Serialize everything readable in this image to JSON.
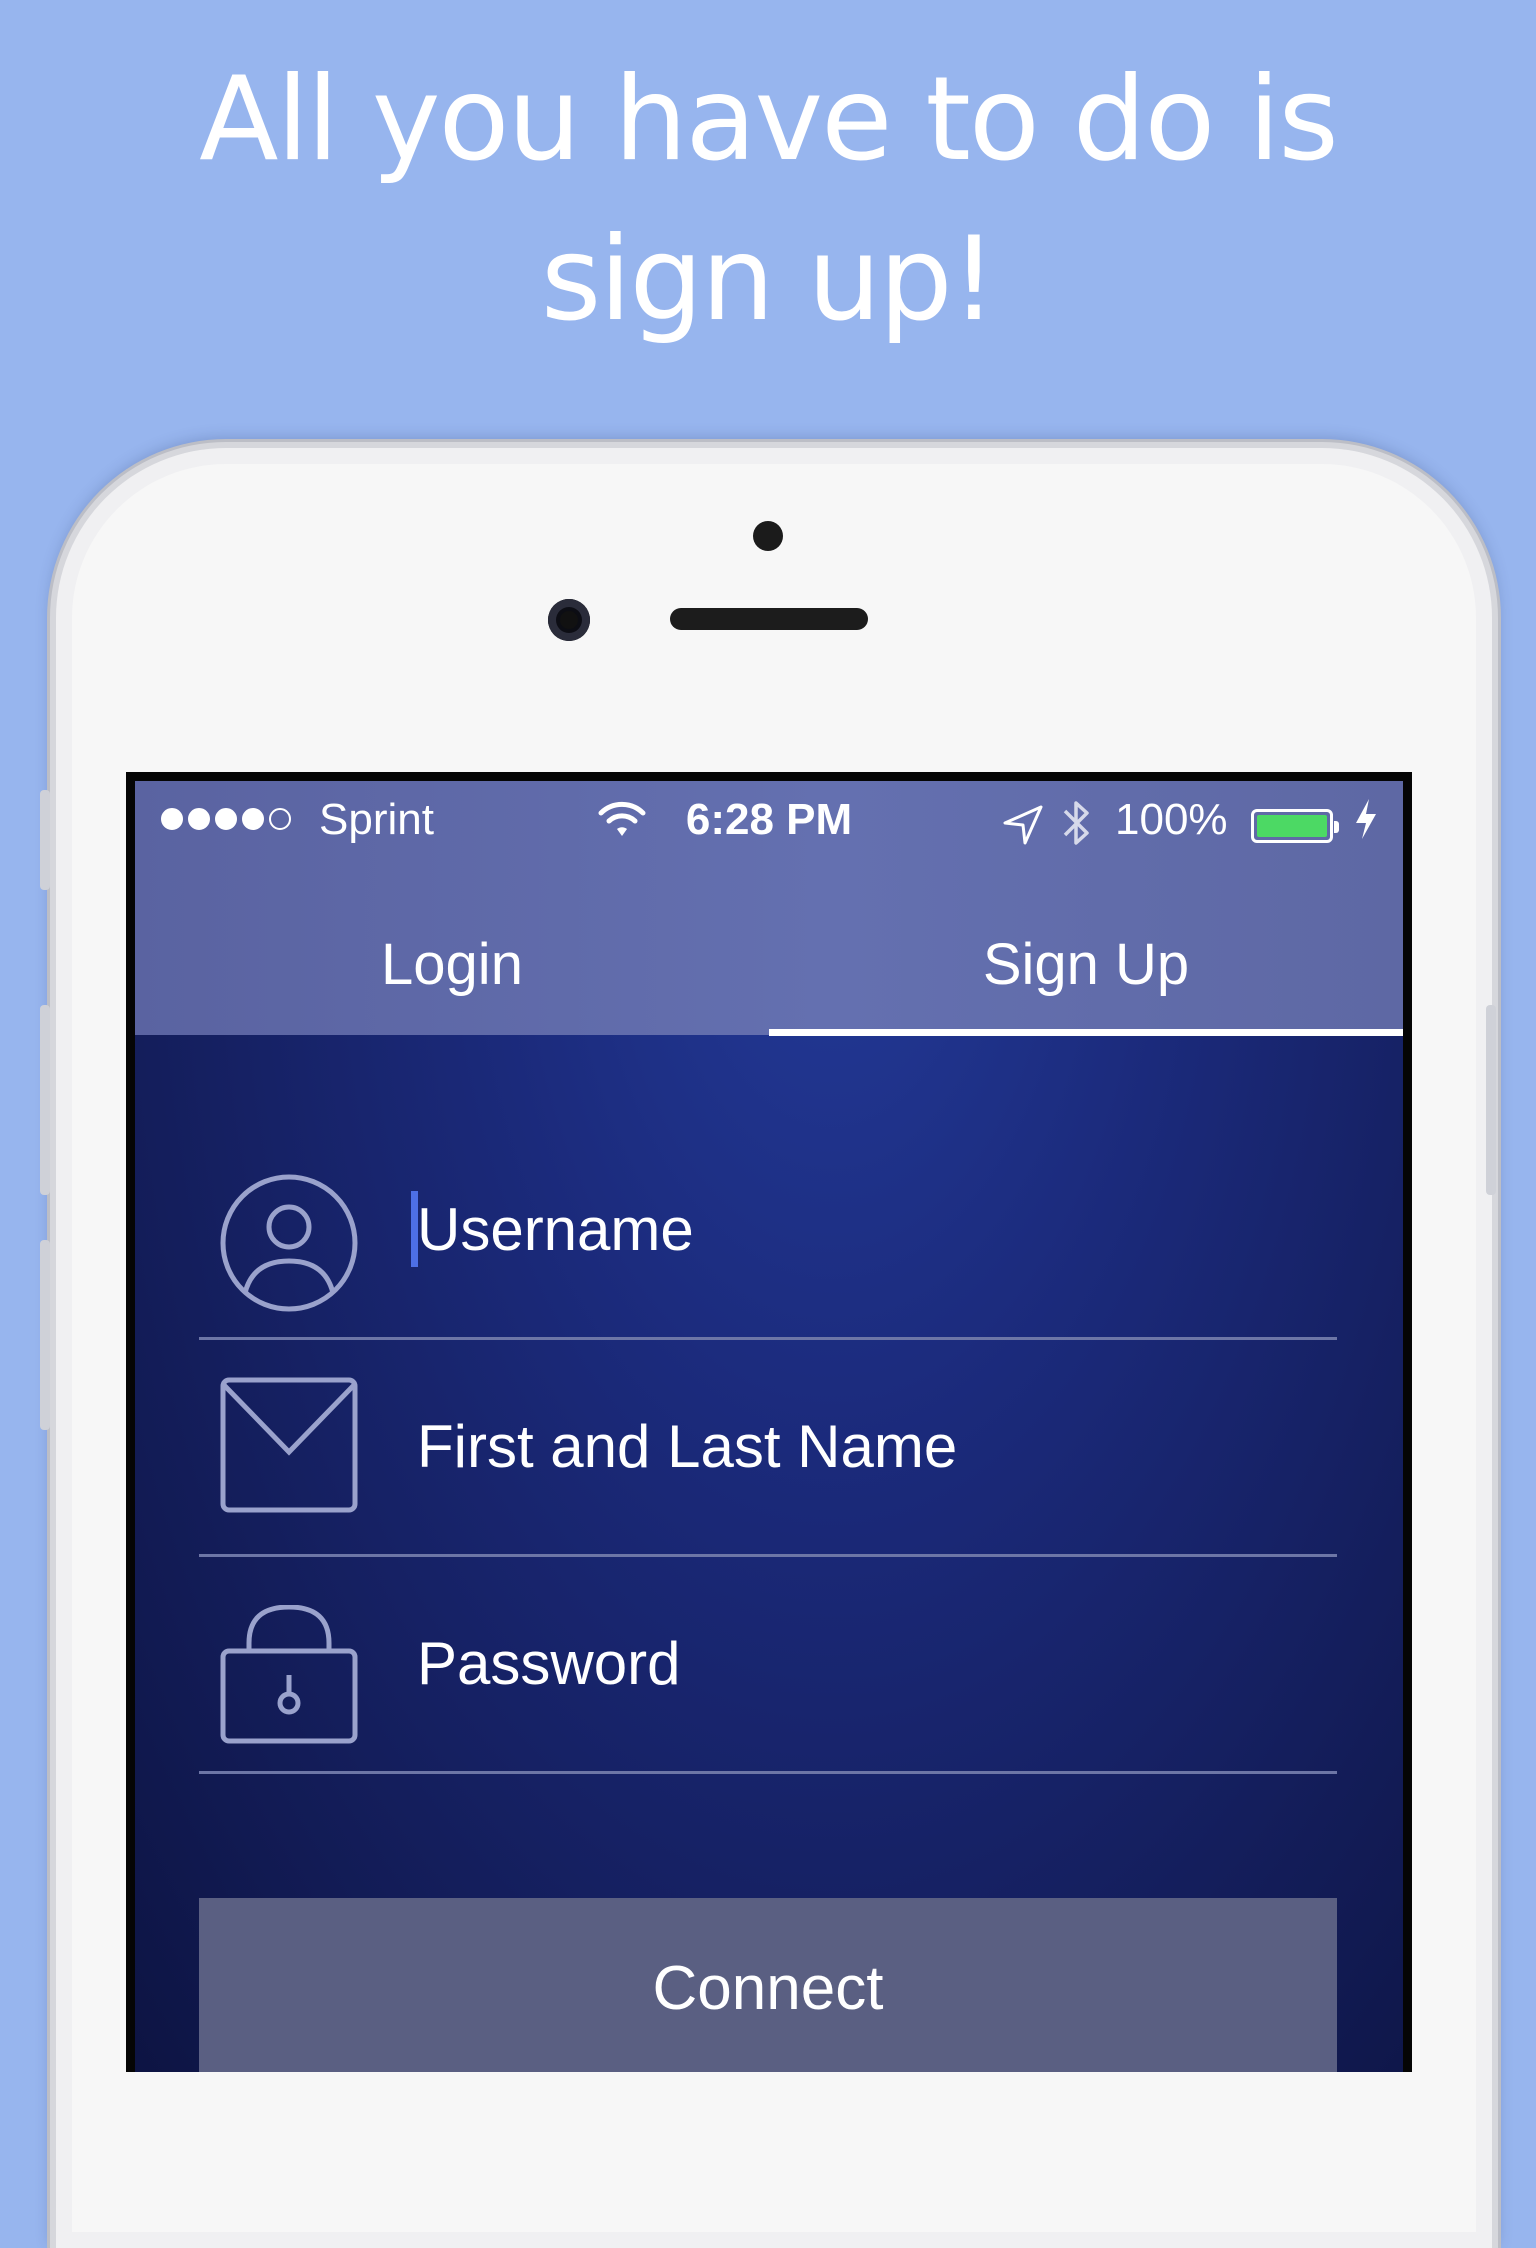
{
  "headline": "All you have to do is sign up!",
  "status_bar": {
    "signal_dots": 5,
    "signal_filled": 4,
    "carrier": "Sprint",
    "time": "6:28 PM",
    "battery_text": "100%",
    "battery_level": 1.0,
    "icons": [
      "wifi-icon",
      "location-arrow-icon",
      "bluetooth-icon",
      "battery-icon",
      "charging-bolt-icon"
    ]
  },
  "tabs": {
    "login": "Login",
    "signup": "Sign Up",
    "active": "signup"
  },
  "form": {
    "username_placeholder": "Username",
    "name_placeholder": "First and Last Name",
    "password_placeholder": "Password",
    "field_icons": [
      "user-icon",
      "mail-icon",
      "lock-icon"
    ]
  },
  "connect_button": "Connect",
  "colors": {
    "background": "#97b5ee",
    "accent": "#4d6fe6",
    "battery": "#4cd964",
    "form_background": "#1b2a7b",
    "button": "#5a5f82"
  }
}
